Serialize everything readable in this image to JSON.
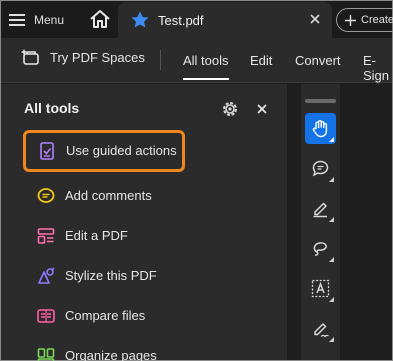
{
  "tabbar": {
    "menu_label": "Menu",
    "tab_title": "Test.pdf",
    "create_label": "Create"
  },
  "toolbar": {
    "spaces_label": "Try PDF Spaces",
    "items": [
      "All tools",
      "Edit",
      "Convert",
      "E-Sign"
    ],
    "active_item": "All tools"
  },
  "panel": {
    "title": "All tools",
    "tools": [
      {
        "label": "Use guided actions",
        "icon": "guided-actions-icon",
        "color": "#b281ff",
        "highlighted": true
      },
      {
        "label": "Add comments",
        "icon": "comment-icon",
        "color": "#f5c518"
      },
      {
        "label": "Edit a PDF",
        "icon": "edit-pdf-icon",
        "color": "#ff6fae"
      },
      {
        "label": "Stylize this PDF",
        "icon": "stylize-icon",
        "color": "#8f7bff"
      },
      {
        "label": "Compare files",
        "icon": "compare-icon",
        "color": "#ff5fa8"
      },
      {
        "label": "Organize pages",
        "icon": "organize-icon",
        "color": "#7ed957"
      }
    ]
  },
  "rail": {
    "tools": [
      "hand-icon",
      "comment-icon",
      "highlighter-icon",
      "lasso-icon",
      "text-select-icon",
      "signature-icon"
    ],
    "active": "hand-icon"
  },
  "colors": {
    "accent": "#1473e6",
    "highlight_border": "#f0861f",
    "star": "#3b8cf5"
  }
}
